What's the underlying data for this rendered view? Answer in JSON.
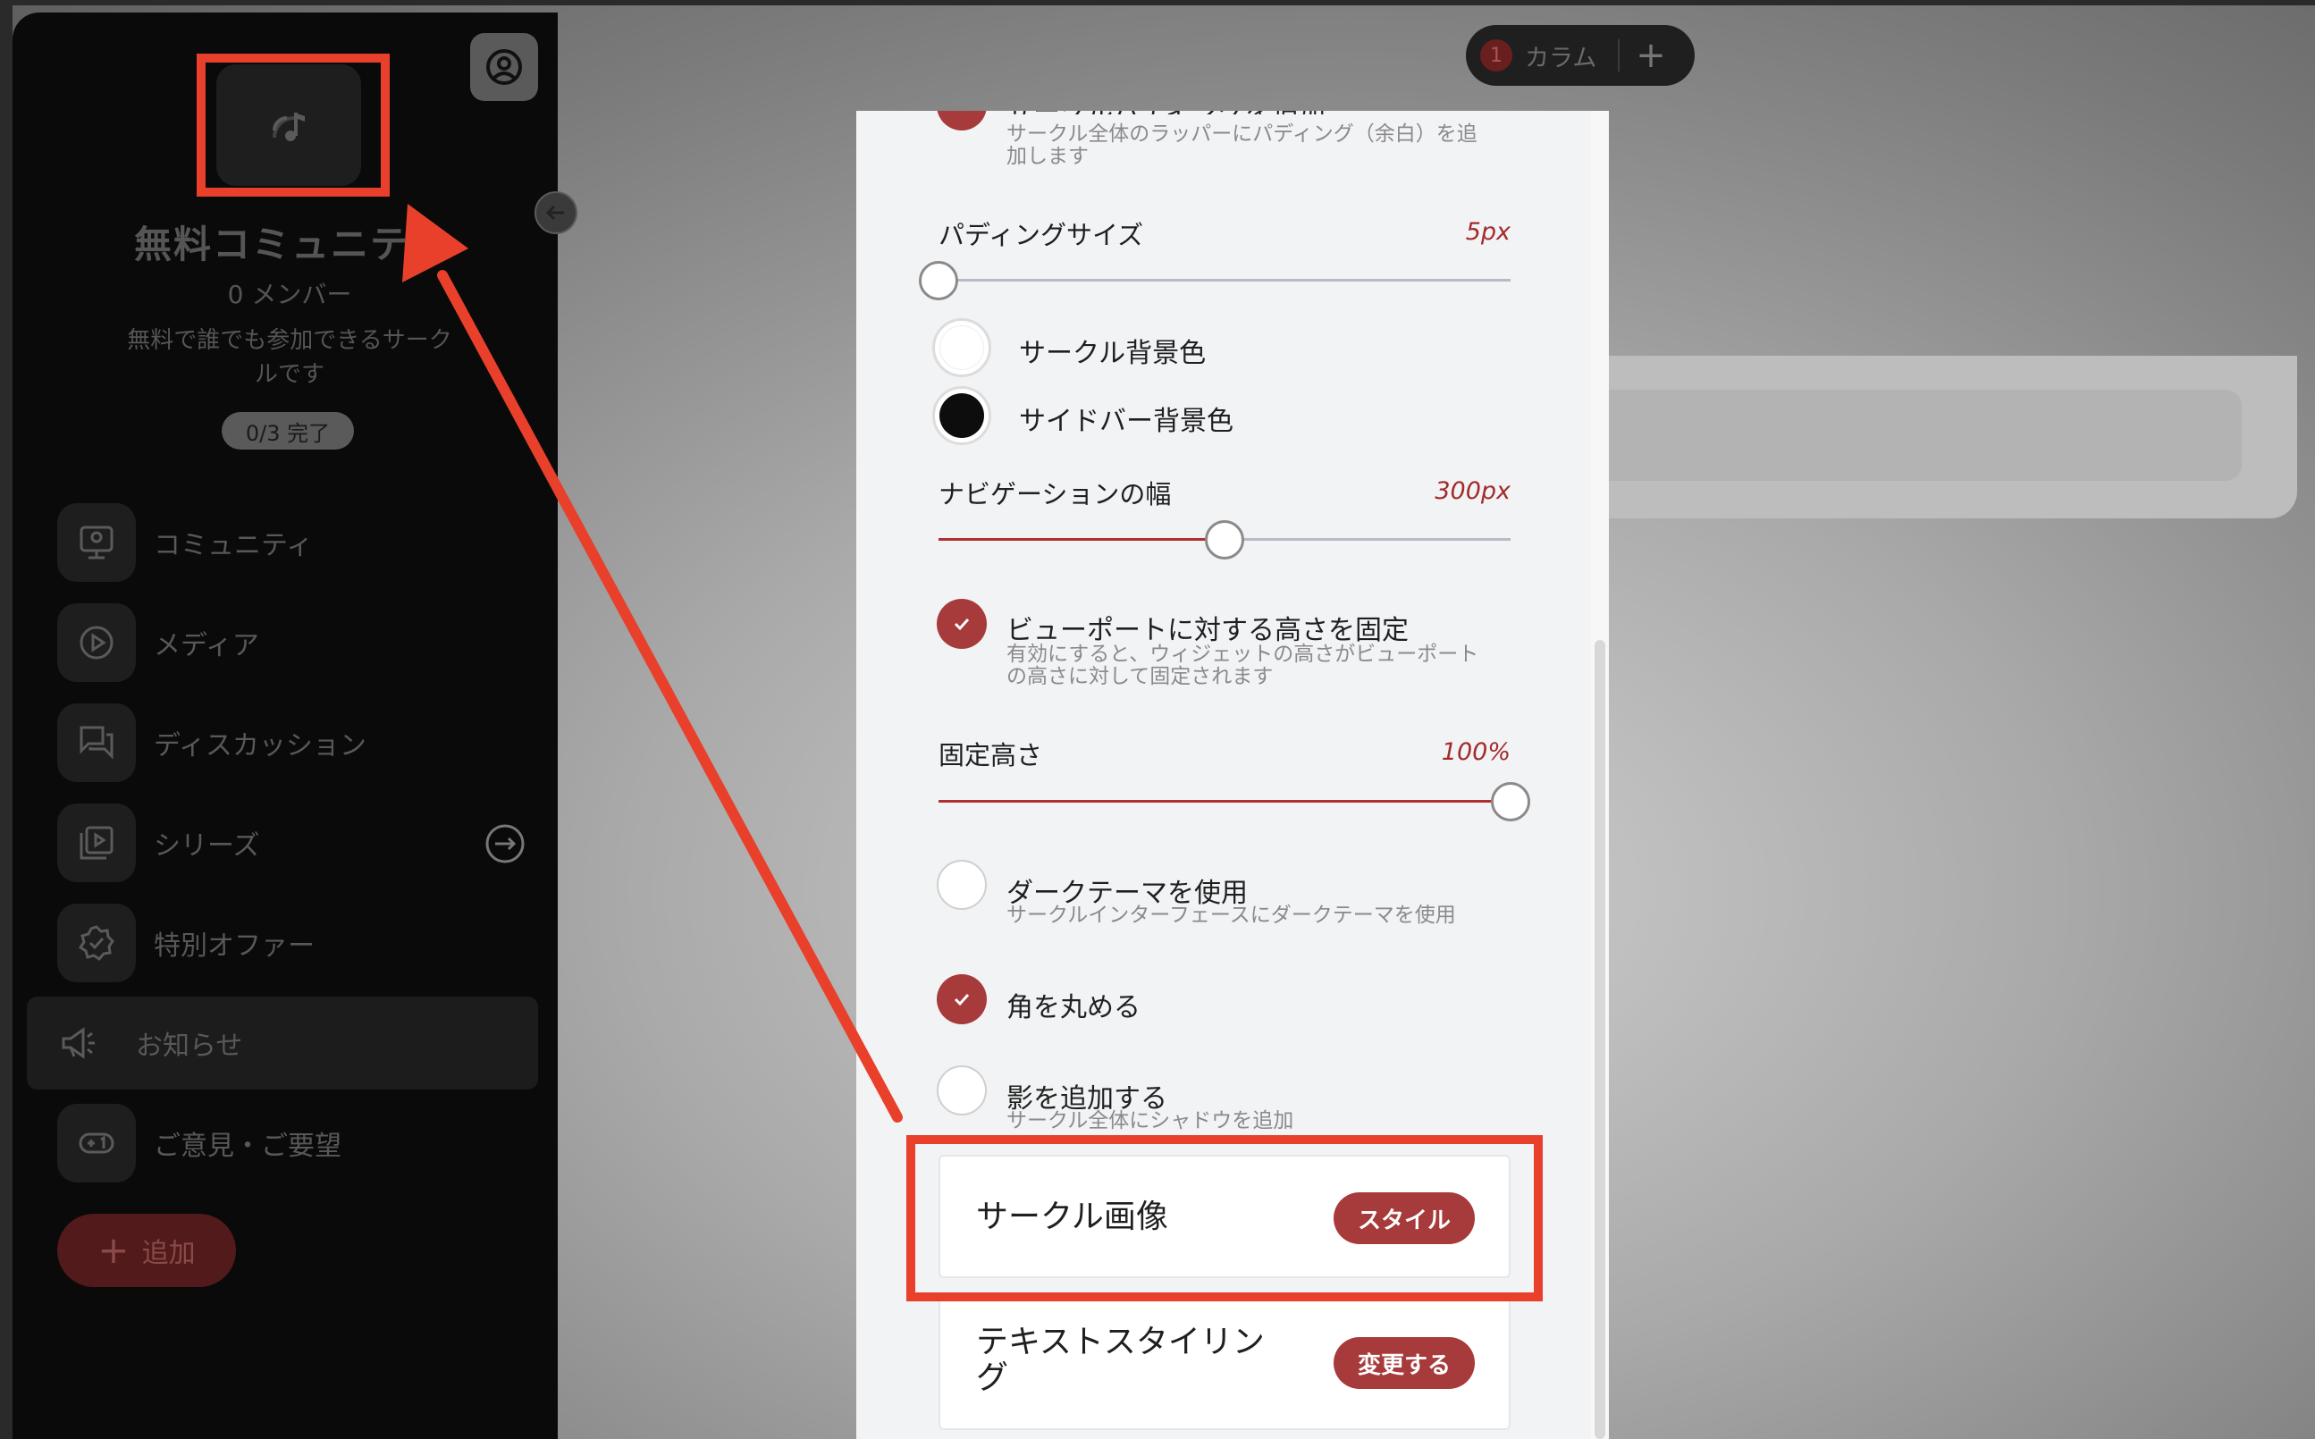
{
  "sidebar": {
    "community_name": "無料コミュニティ",
    "members": "0 メンバー",
    "description": "無料で誰でも参加できるサークルです",
    "progress": "0/3 完了",
    "nav_items": [
      {
        "label": "コミュニティ",
        "icon": "community-icon"
      },
      {
        "label": "メディア",
        "icon": "play-icon"
      },
      {
        "label": "ディスカッション",
        "icon": "chat-icon"
      },
      {
        "label": "シリーズ",
        "icon": "series-icon"
      },
      {
        "label": "特別オファー",
        "icon": "badge-icon"
      },
      {
        "label": "お知らせ",
        "icon": "megaphone-icon"
      },
      {
        "label": "ご意見・ご要望",
        "icon": "feedback-icon"
      }
    ],
    "add_label": "追加"
  },
  "topbar": {
    "column_count": "1",
    "column_label": "カラム",
    "add_symbol": "+"
  },
  "panel": {
    "cut_heading": "サークルパディングを追加",
    "padding_option_sub_1": "サークル全体のラッパーにパディング（余白）を追",
    "padding_option_sub_2": "加します",
    "padding_size_label": "パディングサイズ",
    "padding_size_value": "5px",
    "padding_size_level": 0.0,
    "circle_bg_label": "サークル背景色",
    "sidebar_bg_label": "サイドバー背景色",
    "nav_width_label": "ナビゲーションの幅",
    "nav_width_value": "300px",
    "nav_width_level": 0.5,
    "viewport_label": "ビューポートに対する高さを固定",
    "viewport_sub_1": "有効にすると、ウィジェットの高さがビューポート",
    "viewport_sub_2": "の高さに対して固定されます",
    "fixed_height_label": "固定高さ",
    "fixed_height_value": "100%",
    "fixed_height_level": 1.0,
    "dark_label": "ダークテーマを使用",
    "dark_sub": "サークルインターフェースにダークテーマを使用",
    "round_label": "角を丸める",
    "shadow_label": "影を追加する",
    "shadow_sub": "サークル全体にシャドウを追加",
    "card1_title": "サークル画像",
    "card1_btn": "スタイル",
    "card2_title_1": "テキストスタイリン",
    "card2_title_2": "グ",
    "card2_btn": "変更する"
  },
  "colors": {
    "accent": "#a73a3a",
    "annotation": "#e8402b",
    "circle_bg_swatch": "#ffffff",
    "sidebar_bg_swatch": "#0d0d0d"
  }
}
